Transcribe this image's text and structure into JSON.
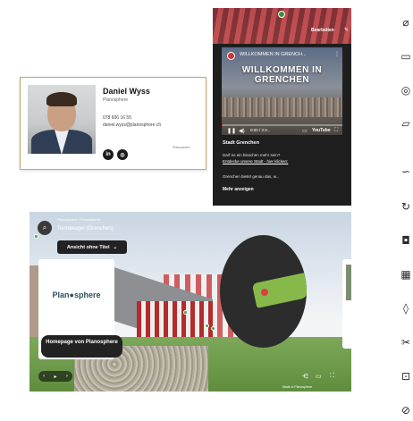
{
  "contact_card": {
    "name": "Daniel Wyss",
    "company": "Planosphere",
    "phone": "078 606 16 55",
    "email": "daniel.wyss@planosphere.ch",
    "social": [
      "in",
      "ig"
    ],
    "logo_text": "Planosphere"
  },
  "video_panel": {
    "edit_label": "Bearbeiten",
    "video_title_small": "WILLKOMMEN IN GRENCH...",
    "video_title": "WILLKOMMEN IN GRENCHEN",
    "time": "0:00 / 2:2...",
    "platform": "YouTube",
    "heading": "Stadt Grenchen",
    "text_1": "Darf es ein bisschen mehr sein?",
    "link": "Entdecke unsere Stadt - hier klicken:",
    "text_2": "Grenchen bietet genau das, w...",
    "more": "Mehr anzeigen"
  },
  "panorama": {
    "sub_title": "Planosphere / Planosphere",
    "location": "Tonnekugel (Grenchen)",
    "dropdown_label": "Ansicht ohne Titel",
    "info_logo": "Plan●sphere",
    "info_button": "Homepage von Planosphere",
    "credit": "Made in Planosphere"
  },
  "toolbar": {
    "icons": [
      "ruler-icon",
      "layers-icon",
      "target-icon",
      "comment-icon",
      "gesture-icon",
      "360-icon",
      "camera-icon",
      "grid-icon",
      "drop-icon",
      "scissors-icon",
      "crop-icon",
      "hide-icon"
    ]
  },
  "colors": {
    "accent_red": "#d23434",
    "dark_panel": "#1e1e1e",
    "card_border": "#c8a46a",
    "grass_green": "#5f8d3d"
  }
}
